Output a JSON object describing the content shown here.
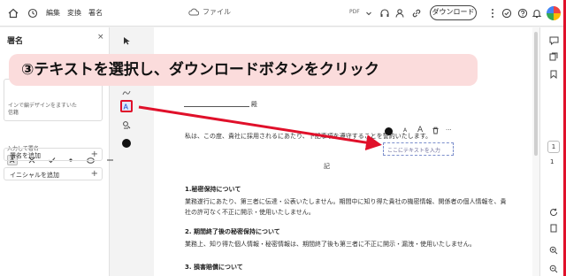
{
  "topbar": {
    "menu": [
      "編集",
      "変換",
      "署名"
    ],
    "file_label": "ファイル",
    "pdf_label": "PDF",
    "download_label": "ダウンロード"
  },
  "left_panel": {
    "title": "署名",
    "close": "×",
    "hint_line1": "インで編デザインをますいた",
    "hint_line2": "信籍",
    "subheading": "入力して署名",
    "add_signature": "署名を追加",
    "add_initials": "イニシャルを追加",
    "plus": "+"
  },
  "document": {
    "sign_suffix": "殿",
    "intro": "私は、この度、貴社に採用されるにあたり、下記事項を遵守することを誓約いたします。",
    "center_mark": "記",
    "s1_title": "1.秘密保持について",
    "s1_line1": "業務遂行にあたり、第三者に伝達・公表いたしません。期間中に知り得た貴社の機密情報、関係者の個人情報を、貴",
    "s1_line2": "社の許可なく不正に開示・使用いたしません。",
    "s2_title": "2. 期間終了後の秘密保持について",
    "s2_line1": "業務上、知り得た個人情報・秘密情報は、期間終了後も第三者に不正に開示・漏洩・使用いたしません。",
    "s3_title": "3. 損害賠償について"
  },
  "text_toolbar": {
    "small_a": "A",
    "big_a": "A",
    "more": "···"
  },
  "text_input": {
    "placeholder": "ここにテキストを入力"
  },
  "callout": {
    "text": "③テキストを選択し、ダウンロードボタンをクリック"
  },
  "right_strip": {
    "page_current": "1",
    "page_total": "1"
  },
  "colors": {
    "accent_red": "#e0102a",
    "callout_bg": "#fbdcdc"
  }
}
